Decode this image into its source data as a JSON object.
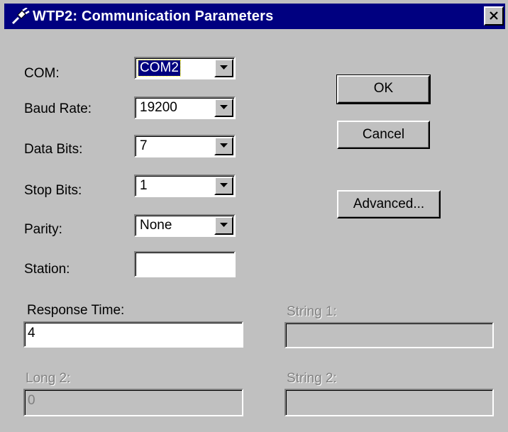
{
  "window": {
    "title": "WTP2: Communication Parameters",
    "title_icon": "plug-icon",
    "close_icon": "close-icon"
  },
  "colors": {
    "face": "#c0c0c0",
    "titlebar": "#000080",
    "disabled_text": "#808080"
  },
  "fields": {
    "com": {
      "label": "COM:",
      "value": "COM2"
    },
    "baud": {
      "label": "Baud Rate:",
      "value": "19200"
    },
    "data_bits": {
      "label": "Data Bits:",
      "value": "7"
    },
    "stop_bits": {
      "label": "Stop Bits:",
      "value": "1"
    },
    "parity": {
      "label": "Parity:",
      "value": "None"
    },
    "station": {
      "label": "Station:",
      "value": ""
    },
    "response_time": {
      "label": "Response Time:",
      "value": "4"
    },
    "string1": {
      "label": "String 1:",
      "value": ""
    },
    "long2": {
      "label": "Long 2:",
      "value": "0"
    },
    "string2": {
      "label": "String 2:",
      "value": ""
    }
  },
  "buttons": {
    "ok": "OK",
    "cancel": "Cancel",
    "advanced": "Advanced..."
  }
}
